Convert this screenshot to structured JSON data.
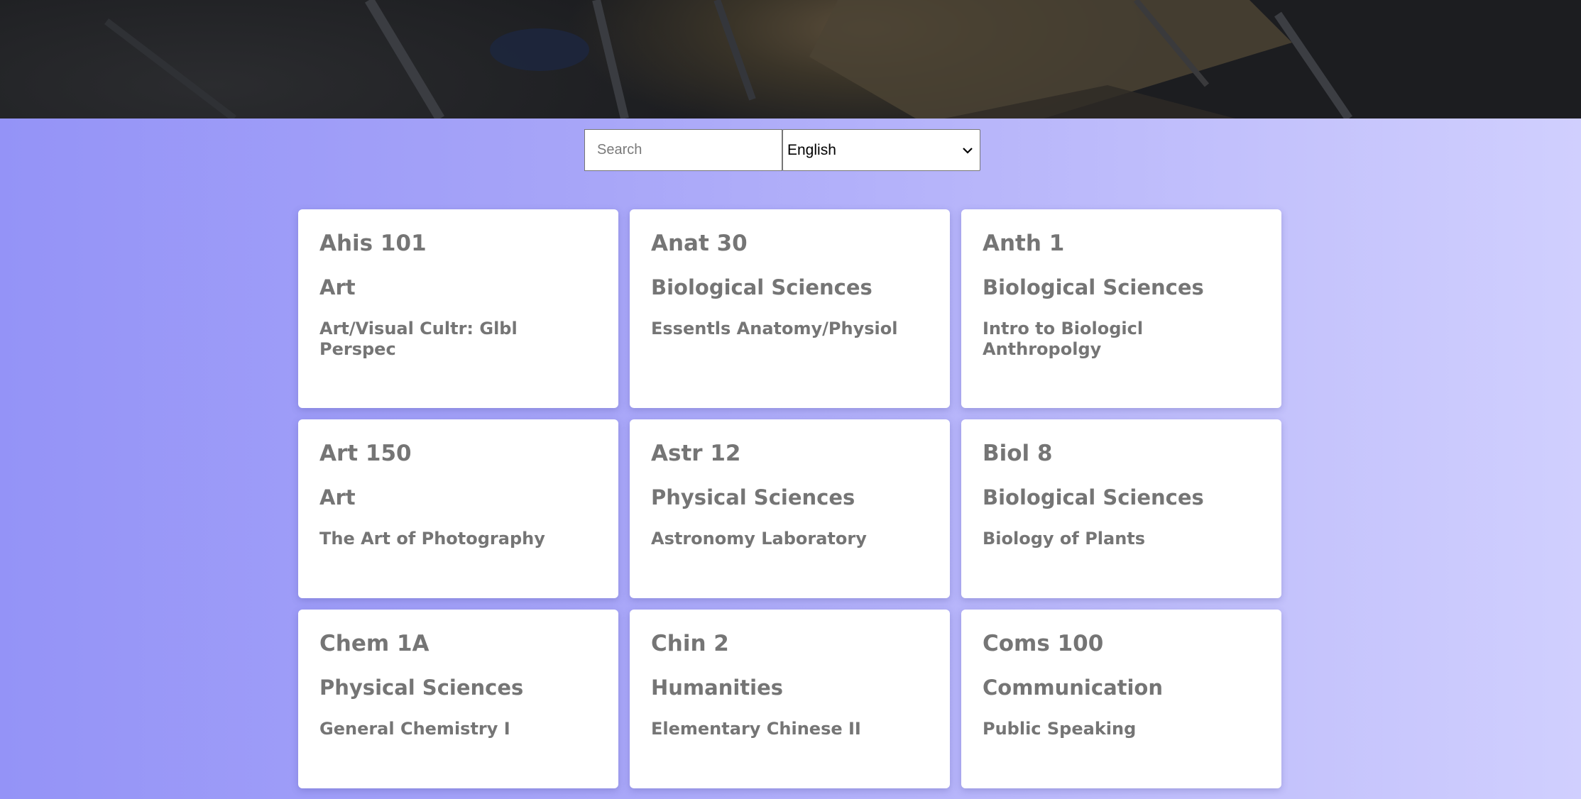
{
  "search": {
    "placeholder": "Search"
  },
  "language": {
    "selected": "English"
  },
  "courses": [
    {
      "code": "Ahis 101",
      "department": "Art",
      "title": "Art/Visual Cultr: Glbl Perspec"
    },
    {
      "code": "Anat 30",
      "department": "Biological Sciences",
      "title": "Essentls Anatomy/Physiol"
    },
    {
      "code": "Anth 1",
      "department": "Biological Sciences",
      "title": "Intro to Biologicl Anthropolgy"
    },
    {
      "code": "Art 150",
      "department": "Art",
      "title": "The Art of Photography"
    },
    {
      "code": "Astr 12",
      "department": "Physical Sciences",
      "title": "Astronomy Laboratory"
    },
    {
      "code": "Biol 8",
      "department": "Biological Sciences",
      "title": "Biology of Plants"
    },
    {
      "code": "Chem 1A",
      "department": "Physical Sciences",
      "title": "General Chemistry I"
    },
    {
      "code": "Chin 2",
      "department": "Humanities",
      "title": "Elementary Chinese II"
    },
    {
      "code": "Coms 100",
      "department": "Communication",
      "title": "Public Speaking"
    }
  ]
}
